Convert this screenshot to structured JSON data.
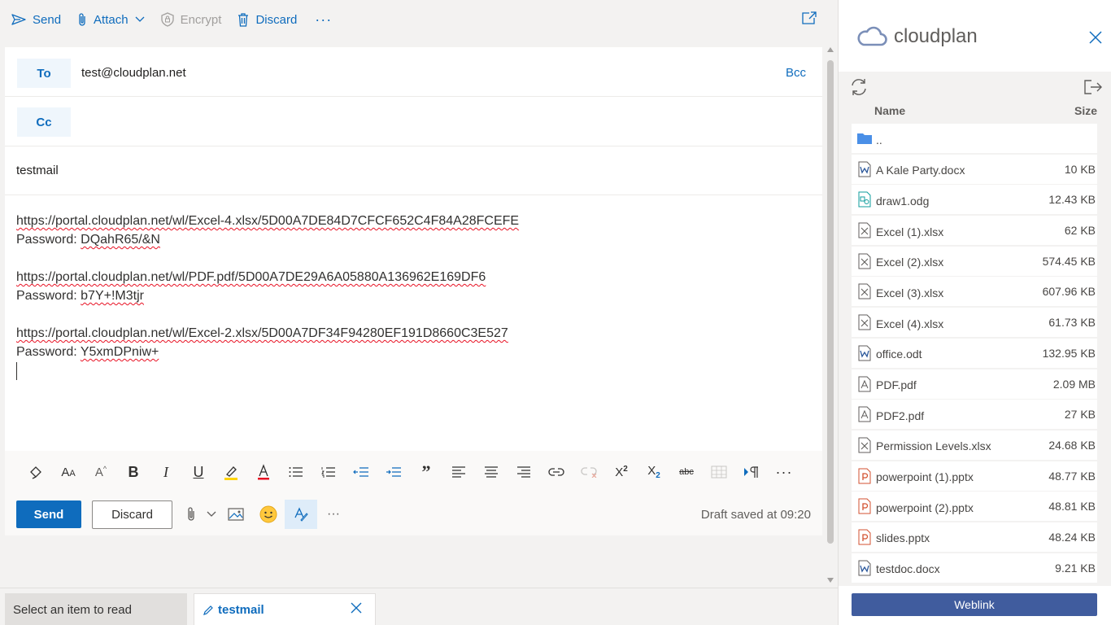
{
  "toolbar": {
    "send": "Send",
    "attach": "Attach",
    "encrypt": "Encrypt",
    "discard": "Discard",
    "more": "···"
  },
  "compose": {
    "to_label": "To",
    "to_value": "test@cloudplan.net",
    "bcc_label": "Bcc",
    "cc_label": "Cc",
    "subject": "testmail",
    "body": {
      "link1": "https://portal.cloudplan.net/wl/Excel-4.xlsx/5D00A7DE84D7CFCF652C4F84A28FCEFE",
      "pass1_label": "Password:",
      "pass1": "DQahR65/&N",
      "link2": "https://portal.cloudplan.net/wl/PDF.pdf/5D00A7DE29A6A05880A136962E169DF6",
      "pass2_label": "Password:",
      "pass2": "b7Y+!M3tjr",
      "link3": "https://portal.cloudplan.net/wl/Excel-2.xlsx/5D00A7DF34F94280EF191D8660C3E527",
      "pass3_label": "Password:",
      "pass3": "Y5xmDPniw+"
    }
  },
  "actions": {
    "send": "Send",
    "discard": "Discard",
    "more": "···",
    "draft_status": "Draft saved at 09:20"
  },
  "bottom_tabs": {
    "read": "Select an item to read",
    "draft": "testmail"
  },
  "panel": {
    "brand": "cloudplan",
    "col_name": "Name",
    "col_size": "Size",
    "parent": "..",
    "files": [
      {
        "name": "A Kale Party.docx",
        "size": "10 KB",
        "type": "word"
      },
      {
        "name": "draw1.odg",
        "size": "12.43 KB",
        "type": "draw"
      },
      {
        "name": "Excel (1).xlsx",
        "size": "62 KB",
        "type": "excel"
      },
      {
        "name": "Excel (2).xlsx",
        "size": "574.45 KB",
        "type": "excel"
      },
      {
        "name": "Excel (3).xlsx",
        "size": "607.96 KB",
        "type": "excel"
      },
      {
        "name": "Excel (4).xlsx",
        "size": "61.73 KB",
        "type": "excel"
      },
      {
        "name": "office.odt",
        "size": "132.95 KB",
        "type": "word"
      },
      {
        "name": "PDF.pdf",
        "size": "2.09 MB",
        "type": "pdf"
      },
      {
        "name": "PDF2.pdf",
        "size": "27 KB",
        "type": "pdf"
      },
      {
        "name": "Permission Levels.xlsx",
        "size": "24.68 KB",
        "type": "excel"
      },
      {
        "name": "powerpoint (1).pptx",
        "size": "48.77 KB",
        "type": "ppt"
      },
      {
        "name": "powerpoint (2).pptx",
        "size": "48.81 KB",
        "type": "ppt"
      },
      {
        "name": "slides.pptx",
        "size": "48.24 KB",
        "type": "ppt"
      },
      {
        "name": "testdoc.docx",
        "size": "9.21 KB",
        "type": "word"
      }
    ],
    "weblink": "Weblink"
  },
  "colors": {
    "accent": "#0f6cbd",
    "weblink_bg": "#405c9e",
    "folder": "#4a8fe7",
    "word": "#2b579a",
    "ppt": "#d35230",
    "draw": "#0f9d9d",
    "neutral_file": "#605e5c"
  }
}
